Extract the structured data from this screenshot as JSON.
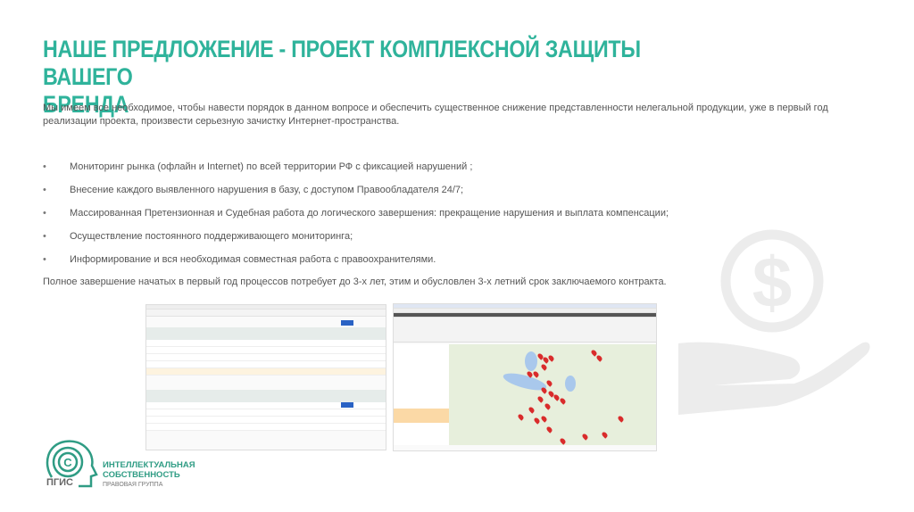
{
  "title": {
    "line1": "НАШЕ ПРЕДЛОЖЕНИЕ - ПРОЕКТ КОМПЛЕКСНОЙ ЗАЩИТЫ ВАШЕГО",
    "line2": "БРЕНДА"
  },
  "intro": "Мы имеем все необходимое, чтобы навести порядок в данном вопросе и обеспечить существенное снижение представленности нелегальной продукции, уже в первый год реализации проекта, произвести серьезную зачистку Интернет-пространства.",
  "bullets": [
    "Мониторинг рынка (офлайн  и Internet) по всей территории РФ с фиксацией нарушений ;",
    "Внесение каждого выявленного нарушения в базу, с доступом Правообладателя 24/7;",
    "Массированная Претензионная и Судебная работа до логического завершения: прекращение нарушения и выплата компенсации;",
    "Осуществление постоянного поддерживающего мониторинга;",
    "Информирование и вся необходимая совместная работа с правоохранителями."
  ],
  "bullet_marker": "•",
  "closing": "Полное завершение начатых в первый год процессов потребует до 3-х лет,  этим и обусловлен 3-х летний срок заключаемого контракта.",
  "logo": {
    "abbr": "ПГИС",
    "line1": "ИНТЕЛЛЕКТУАЛЬНАЯ",
    "line2": "СОБСТВЕННОСТЬ",
    "line3": "ПРАВОВАЯ ГРУППА"
  },
  "colors": {
    "accent": "#2fb39b",
    "text": "#555555",
    "decor": "#ececec"
  }
}
